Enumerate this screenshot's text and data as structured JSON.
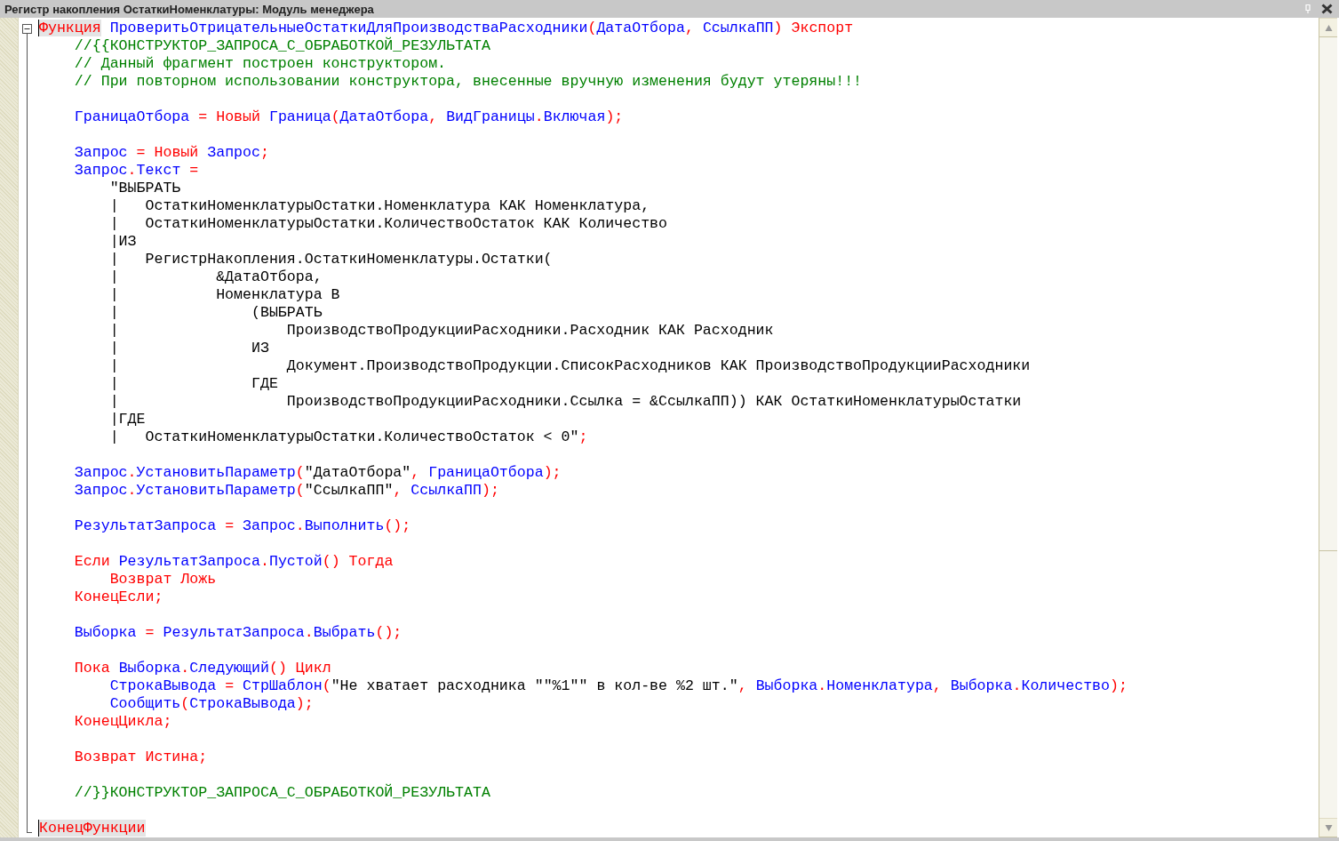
{
  "window": {
    "title": "Регистр накопления ОстаткиНоменклатуры: Модуль менеджера"
  },
  "editor": {
    "lines": [
      {
        "kind": "code",
        "tokens": [
          {
            "kind": "match",
            "text": "Функция"
          },
          {
            "kind": "id",
            "text": " ПроверитьОтрицательныеОстаткиДляПроизводстваРасходники"
          },
          {
            "kind": "kw",
            "text": "("
          },
          {
            "kind": "id",
            "text": "ДатаОтбора"
          },
          {
            "kind": "kw",
            "text": ", "
          },
          {
            "kind": "id",
            "text": "СсылкаПП"
          },
          {
            "kind": "kw",
            "text": ") Экспорт"
          }
        ]
      },
      {
        "kind": "code",
        "tokens": [
          {
            "kind": "cm",
            "text": "    //{{КОНСТРУКТОР_ЗАПРОСА_С_ОБРАБОТКОЙ_РЕЗУЛЬТАТА"
          }
        ]
      },
      {
        "kind": "code",
        "tokens": [
          {
            "kind": "cm",
            "text": "    // Данный фрагмент построен конструктором."
          }
        ]
      },
      {
        "kind": "code",
        "tokens": [
          {
            "kind": "cm",
            "text": "    // При повторном использовании конструктора, внесенные вручную изменения будут утеряны!!!"
          }
        ]
      },
      {
        "kind": "blank"
      },
      {
        "kind": "code",
        "tokens": [
          {
            "kind": "id",
            "text": "    ГраницаОтбора"
          },
          {
            "kind": "kw",
            "text": " = Новый "
          },
          {
            "kind": "id",
            "text": "Граница"
          },
          {
            "kind": "kw",
            "text": "("
          },
          {
            "kind": "id",
            "text": "ДатаОтбора"
          },
          {
            "kind": "kw",
            "text": ", "
          },
          {
            "kind": "id",
            "text": "ВидГраницы"
          },
          {
            "kind": "kw",
            "text": "."
          },
          {
            "kind": "id",
            "text": "Включая"
          },
          {
            "kind": "kw",
            "text": ");"
          }
        ]
      },
      {
        "kind": "blank"
      },
      {
        "kind": "code",
        "tokens": [
          {
            "kind": "id",
            "text": "    Запрос"
          },
          {
            "kind": "kw",
            "text": " = Новый "
          },
          {
            "kind": "id",
            "text": "Запрос"
          },
          {
            "kind": "kw",
            "text": ";"
          }
        ]
      },
      {
        "kind": "code",
        "tokens": [
          {
            "kind": "id",
            "text": "    Запрос"
          },
          {
            "kind": "kw",
            "text": "."
          },
          {
            "kind": "id",
            "text": "Текст"
          },
          {
            "kind": "kw",
            "text": " ="
          }
        ]
      },
      {
        "kind": "code",
        "tokens": [
          {
            "kind": "tx",
            "text": "        \"ВЫБРАТЬ"
          }
        ]
      },
      {
        "kind": "code",
        "tokens": [
          {
            "kind": "tx",
            "text": "        |   ОстаткиНоменклатурыОстатки.Номенклатура КАК Номенклатура,"
          }
        ]
      },
      {
        "kind": "code",
        "tokens": [
          {
            "kind": "tx",
            "text": "        |   ОстаткиНоменклатурыОстатки.КоличествоОстаток КАК Количество"
          }
        ]
      },
      {
        "kind": "code",
        "tokens": [
          {
            "kind": "tx",
            "text": "        |ИЗ"
          }
        ]
      },
      {
        "kind": "code",
        "tokens": [
          {
            "kind": "tx",
            "text": "        |   РегистрНакопления.ОстаткиНоменклатуры.Остатки("
          }
        ]
      },
      {
        "kind": "code",
        "tokens": [
          {
            "kind": "tx",
            "text": "        |           &ДатаОтбора,"
          }
        ]
      },
      {
        "kind": "code",
        "tokens": [
          {
            "kind": "tx",
            "text": "        |           Номенклатура В"
          }
        ]
      },
      {
        "kind": "code",
        "tokens": [
          {
            "kind": "tx",
            "text": "        |               (ВЫБРАТЬ"
          }
        ]
      },
      {
        "kind": "code",
        "tokens": [
          {
            "kind": "tx",
            "text": "        |                   ПроизводствоПродукцииРасходники.Расходник КАК Расходник"
          }
        ]
      },
      {
        "kind": "code",
        "tokens": [
          {
            "kind": "tx",
            "text": "        |               ИЗ"
          }
        ]
      },
      {
        "kind": "code",
        "tokens": [
          {
            "kind": "tx",
            "text": "        |                   Документ.ПроизводствоПродукции.СписокРасходников КАК ПроизводствоПродукцииРасходники"
          }
        ]
      },
      {
        "kind": "code",
        "tokens": [
          {
            "kind": "tx",
            "text": "        |               ГДЕ"
          }
        ]
      },
      {
        "kind": "code",
        "tokens": [
          {
            "kind": "tx",
            "text": "        |                   ПроизводствоПродукцииРасходники.Ссылка = &СсылкаПП)) КАК ОстаткиНоменклатурыОстатки"
          }
        ]
      },
      {
        "kind": "code",
        "tokens": [
          {
            "kind": "tx",
            "text": "        |ГДЕ"
          }
        ]
      },
      {
        "kind": "code",
        "tokens": [
          {
            "kind": "tx",
            "text": "        |   ОстаткиНоменклатурыОстатки.КоличествоОстаток < 0\""
          },
          {
            "kind": "kw",
            "text": ";"
          }
        ]
      },
      {
        "kind": "blank"
      },
      {
        "kind": "code",
        "tokens": [
          {
            "kind": "id",
            "text": "    Запрос"
          },
          {
            "kind": "kw",
            "text": "."
          },
          {
            "kind": "id",
            "text": "УстановитьПараметр"
          },
          {
            "kind": "kw",
            "text": "("
          },
          {
            "kind": "tx",
            "text": "\"ДатаОтбора\""
          },
          {
            "kind": "kw",
            "text": ", "
          },
          {
            "kind": "id",
            "text": "ГраницаОтбора"
          },
          {
            "kind": "kw",
            "text": ");"
          }
        ]
      },
      {
        "kind": "code",
        "tokens": [
          {
            "kind": "id",
            "text": "    Запрос"
          },
          {
            "kind": "kw",
            "text": "."
          },
          {
            "kind": "id",
            "text": "УстановитьПараметр"
          },
          {
            "kind": "kw",
            "text": "("
          },
          {
            "kind": "tx",
            "text": "\"СсылкаПП\""
          },
          {
            "kind": "kw",
            "text": ", "
          },
          {
            "kind": "id",
            "text": "СсылкаПП"
          },
          {
            "kind": "kw",
            "text": ");"
          }
        ]
      },
      {
        "kind": "blank"
      },
      {
        "kind": "code",
        "tokens": [
          {
            "kind": "id",
            "text": "    РезультатЗапроса"
          },
          {
            "kind": "kw",
            "text": " = "
          },
          {
            "kind": "id",
            "text": "Запрос"
          },
          {
            "kind": "kw",
            "text": "."
          },
          {
            "kind": "id",
            "text": "Выполнить"
          },
          {
            "kind": "kw",
            "text": "();"
          }
        ]
      },
      {
        "kind": "blank"
      },
      {
        "kind": "code",
        "tokens": [
          {
            "kind": "kw",
            "text": "    Если "
          },
          {
            "kind": "id",
            "text": "РезультатЗапроса"
          },
          {
            "kind": "kw",
            "text": "."
          },
          {
            "kind": "id",
            "text": "Пустой"
          },
          {
            "kind": "kw",
            "text": "() Тогда"
          }
        ]
      },
      {
        "kind": "code",
        "tokens": [
          {
            "kind": "kw",
            "text": "        Возврат Ложь"
          }
        ]
      },
      {
        "kind": "code",
        "tokens": [
          {
            "kind": "kw",
            "text": "    КонецЕсли;"
          }
        ]
      },
      {
        "kind": "blank"
      },
      {
        "kind": "code",
        "tokens": [
          {
            "kind": "id",
            "text": "    Выборка"
          },
          {
            "kind": "kw",
            "text": " = "
          },
          {
            "kind": "id",
            "text": "РезультатЗапроса"
          },
          {
            "kind": "kw",
            "text": "."
          },
          {
            "kind": "id",
            "text": "Выбрать"
          },
          {
            "kind": "kw",
            "text": "();"
          }
        ]
      },
      {
        "kind": "blank"
      },
      {
        "kind": "code",
        "tokens": [
          {
            "kind": "kw",
            "text": "    Пока "
          },
          {
            "kind": "id",
            "text": "Выборка"
          },
          {
            "kind": "kw",
            "text": "."
          },
          {
            "kind": "id",
            "text": "Следующий"
          },
          {
            "kind": "kw",
            "text": "() Цикл"
          }
        ]
      },
      {
        "kind": "code",
        "tokens": [
          {
            "kind": "id",
            "text": "        СтрокаВывода"
          },
          {
            "kind": "kw",
            "text": " = "
          },
          {
            "kind": "id",
            "text": "СтрШаблон"
          },
          {
            "kind": "kw",
            "text": "("
          },
          {
            "kind": "tx",
            "text": "\"Не хватает расходника \"\"%1\"\" в кол-ве %2 шт.\""
          },
          {
            "kind": "kw",
            "text": ", "
          },
          {
            "kind": "id",
            "text": "Выборка"
          },
          {
            "kind": "kw",
            "text": "."
          },
          {
            "kind": "id",
            "text": "Номенклатура"
          },
          {
            "kind": "kw",
            "text": ", "
          },
          {
            "kind": "id",
            "text": "Выборка"
          },
          {
            "kind": "kw",
            "text": "."
          },
          {
            "kind": "id",
            "text": "Количество"
          },
          {
            "kind": "kw",
            "text": ");"
          }
        ]
      },
      {
        "kind": "code",
        "tokens": [
          {
            "kind": "id",
            "text": "        Сообщить"
          },
          {
            "kind": "kw",
            "text": "("
          },
          {
            "kind": "id",
            "text": "СтрокаВывода"
          },
          {
            "kind": "kw",
            "text": ");"
          }
        ]
      },
      {
        "kind": "code",
        "tokens": [
          {
            "kind": "kw",
            "text": "    КонецЦикла;"
          }
        ]
      },
      {
        "kind": "blank"
      },
      {
        "kind": "code",
        "tokens": [
          {
            "kind": "kw",
            "text": "    Возврат Истина;"
          }
        ]
      },
      {
        "kind": "blank"
      },
      {
        "kind": "code",
        "tokens": [
          {
            "kind": "cm",
            "text": "    //}}КОНСТРУКТОР_ЗАПРОСА_С_ОБРАБОТКОЙ_РЕЗУЛЬТАТА"
          }
        ]
      },
      {
        "kind": "blank"
      },
      {
        "kind": "code",
        "tokens": [
          {
            "kind": "match",
            "text": "КонецФункции"
          }
        ]
      }
    ]
  }
}
